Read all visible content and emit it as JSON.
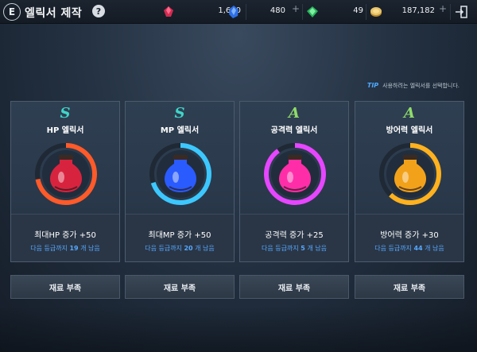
{
  "header": {
    "title": "엘릭서 제작",
    "back_icon_label": "E",
    "help_label": "?"
  },
  "currencies": [
    {
      "name": "red-gem",
      "value": "1,610",
      "color": "#e23a5c",
      "has_plus": false
    },
    {
      "name": "blue-crystal",
      "value": "480",
      "color": "#3a8cff",
      "has_plus": true
    },
    {
      "name": "green-gem",
      "value": "49",
      "color": "#39c765",
      "has_plus": false
    },
    {
      "name": "gold-coin",
      "value": "187,182",
      "color": "#d7b35a",
      "has_plus": true
    }
  ],
  "tip": {
    "label": "TIP",
    "text": "사용하려는 엘릭서를 선택합니다."
  },
  "cards": [
    {
      "grade": "S",
      "grade_class": "s",
      "name": "HP 엘릭서",
      "stat": "최대HP 증가 +50",
      "next_prefix": "다음 등급까지",
      "next_count": "19",
      "next_suffix": "개 남음",
      "button": "재료 부족",
      "ring_color": "#ff5a2a",
      "ring_color2": "#d12a1a",
      "progress": 0.72,
      "potion_color": "#d8233f",
      "potion_glow": "#ff4d6a"
    },
    {
      "grade": "S",
      "grade_class": "s",
      "name": "MP 엘릭서",
      "stat": "최대MP 증가 +50",
      "next_prefix": "다음 등급까지",
      "next_count": "20",
      "next_suffix": "개 남음",
      "button": "재료 부족",
      "ring_color": "#3cc8ff",
      "ring_color2": "#1a8fd6",
      "progress": 0.7,
      "potion_color": "#2a5bff",
      "potion_glow": "#6aa0ff"
    },
    {
      "grade": "A",
      "grade_class": "a",
      "name": "공격력 엘릭서",
      "stat": "공격력 증가 +25",
      "next_prefix": "다음 등급까지",
      "next_count": "5",
      "next_suffix": "개 남음",
      "button": "재료 부족",
      "ring_color": "#e646ff",
      "ring_color2": "#b42ad6",
      "progress": 0.9,
      "potion_color": "#ff2ea8",
      "potion_glow": "#ff7ad4"
    },
    {
      "grade": "A",
      "grade_class": "a",
      "name": "방어력 엘릭서",
      "stat": "방어력 증가 +30",
      "next_prefix": "다음 등급까지",
      "next_count": "44",
      "next_suffix": "개 남음",
      "button": "재료 부족",
      "ring_color": "#ffb21e",
      "ring_color2": "#e08a10",
      "progress": 0.62,
      "potion_color": "#f2a21a",
      "potion_glow": "#ffd46a"
    }
  ]
}
